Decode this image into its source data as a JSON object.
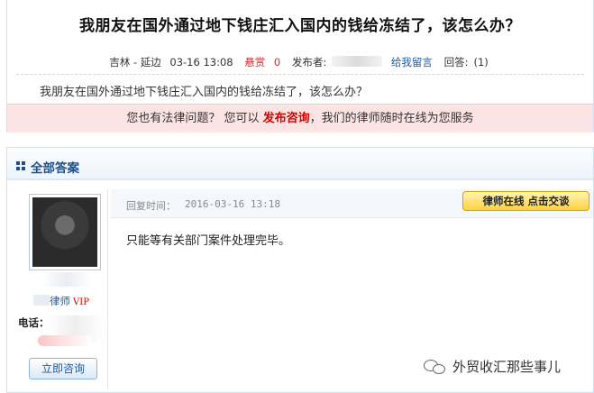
{
  "question": {
    "title": "我朋友在国外通过地下钱庄汇入国内的钱给冻结了，该怎么办？",
    "location": "吉林 - 延边",
    "time": "03-16 13:08",
    "reward_label": "悬赏",
    "reward_value": "0",
    "publisher_label": "发布者:",
    "leave_message_link": "给我留言",
    "answers_count_label": "回答:",
    "answers_count": "(1)",
    "body": "我朋友在国外通过地下钱庄汇入国内的钱给冻结了，该怎么办？"
  },
  "promo": {
    "prefix": "您也有法律问题？ 您可以",
    "highlight": "发布咨询",
    "suffix": "，我们的律师随时在线为您服务"
  },
  "answers": {
    "header_title": "全部答案",
    "lawyer": {
      "name_suffix": "律师",
      "vip": "VIP",
      "phone_label": "电话：",
      "consult_button": "立即咨询"
    },
    "reply": {
      "time_label": "回复时间：",
      "time": "2016-03-16 13:18",
      "chat_button": "律师在线 点击交谈",
      "text": "只能等有关部门案件处理完毕。"
    }
  },
  "watermark": {
    "text": "外贸收汇那些事儿"
  }
}
